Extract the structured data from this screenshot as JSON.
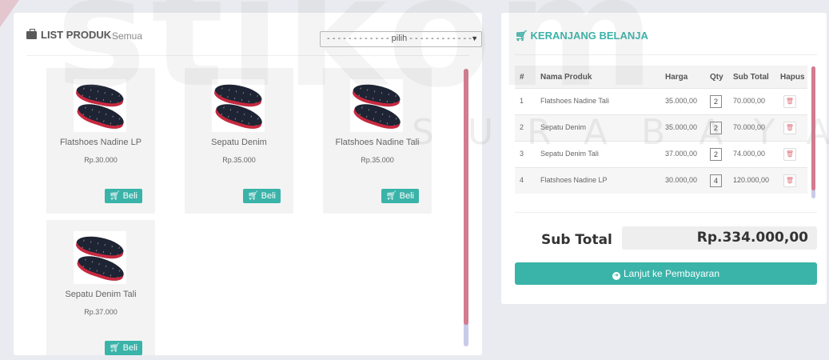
{
  "watermark": {
    "main": "stikom",
    "sub": "SURABAYA"
  },
  "product_list": {
    "title": "LIST PRODUK",
    "subtitle": "Semua",
    "filter": {
      "selected": "- - - - - - - - - - - - pilih - - - - - - - - - - - - -"
    },
    "products": [
      {
        "name": "Flatshoes Nadine LP",
        "price": "Rp.30.000",
        "buy_label": "Beli"
      },
      {
        "name": "Sepatu Denim",
        "price": "Rp.35.000",
        "buy_label": "Beli"
      },
      {
        "name": "Flatshoes Nadine Tali",
        "price": "Rp.35.000",
        "buy_label": "Beli"
      },
      {
        "name": "Sepatu Denim Tali",
        "price": "Rp.37.000",
        "buy_label": "Beli"
      }
    ]
  },
  "cart": {
    "title": "KERANJANG BELANJA",
    "columns": {
      "no": "#",
      "name": "Nama Produk",
      "harga": "Harga",
      "qty": "Qty",
      "subtotal": "Sub Total",
      "hapus": "Hapus"
    },
    "rows": [
      {
        "no": "1",
        "name": "Flatshoes Nadine Tali",
        "harga": "35.000,00",
        "qty": "2",
        "subtotal": "70.000,00"
      },
      {
        "no": "2",
        "name": "Sepatu Denim",
        "harga": "35.000,00",
        "qty": "2",
        "subtotal": "70.000,00"
      },
      {
        "no": "3",
        "name": "Sepatu Denim Tali",
        "harga": "37.000,00",
        "qty": "2",
        "subtotal": "74.000,00"
      },
      {
        "no": "4",
        "name": "Flatshoes Nadine LP",
        "harga": "30.000,00",
        "qty": "4",
        "subtotal": "120.000,00"
      }
    ],
    "subtotal_label": "Sub Total",
    "subtotal_value": "Rp.334.000,00",
    "checkout_label": "Lanjut ke Pembayaran"
  },
  "colors": {
    "accent": "#3ab3a9",
    "scroll_thumb": "#d37b8f",
    "scroll_track": "#c9cbe8",
    "delete": "#e0737f"
  },
  "icons": {
    "panel": "briefcase-icon",
    "cart": "cart-icon",
    "buy": "cart-icon",
    "delete": "trash-icon",
    "checkout": "arrow-circle-right-icon",
    "select": "caret-down-icon"
  }
}
